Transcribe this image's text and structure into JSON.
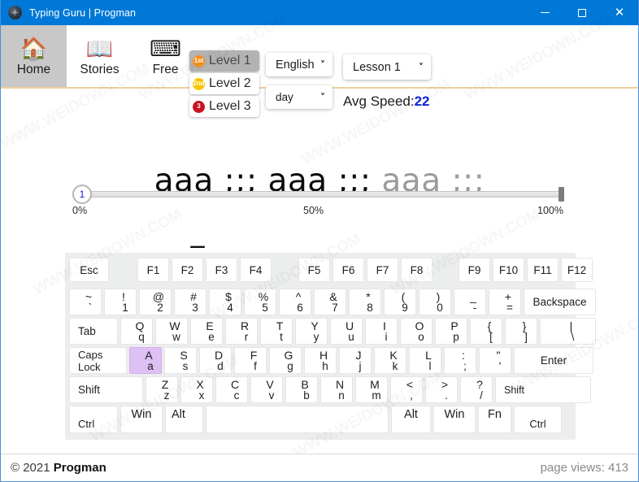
{
  "window": {
    "title": "Typing Guru | Progman",
    "app_icon": "atom-icon",
    "minimize_label": "–",
    "maximize_label": "□",
    "close_label": "✕"
  },
  "toolbar": {
    "nav": [
      {
        "id": "home",
        "label": "Home",
        "icon": "house-icon",
        "glyph": "🏠",
        "active": true
      },
      {
        "id": "stories",
        "label": "Stories",
        "icon": "open-book-icon",
        "glyph": "📖",
        "active": false
      },
      {
        "id": "free",
        "label": "Free",
        "icon": "keyboard-hands-icon",
        "glyph": "⌨",
        "active": false
      }
    ],
    "levels": [
      {
        "label": "Level 1",
        "badge": "1st",
        "badge_color": "#f5921e",
        "selected": true
      },
      {
        "label": "Level 2",
        "badge": "2nd",
        "badge_color": "#f7c600",
        "selected": false
      },
      {
        "label": "Level 3",
        "badge": "3",
        "badge_color": "#cc1122",
        "selected": false
      }
    ],
    "language_select": {
      "value": "English",
      "chevron": "⌄"
    },
    "unit_select": {
      "value": "day",
      "chevron": "⌄"
    },
    "lesson_select": {
      "value": "Lesson 1",
      "chevron": "⌄"
    },
    "avg_speed": {
      "label": "Avg Speed:",
      "value": "22"
    }
  },
  "progress": {
    "knob_value": "1",
    "ticks": {
      "start": "0%",
      "middle": "50%",
      "end": "100%"
    }
  },
  "typing": {
    "typed_text": "aaa ;;; aaa ;;; ",
    "remaining_text": "aaa ;;;",
    "input_display": "_"
  },
  "keyboard": {
    "highlighted_key": "A",
    "rows": {
      "fn": [
        "Esc",
        "F1",
        "F2",
        "F3",
        "F4",
        "F5",
        "F6",
        "F7",
        "F8",
        "F9",
        "F10",
        "F11",
        "F12"
      ],
      "num": [
        {
          "up": "~",
          "lo": "`"
        },
        {
          "up": "!",
          "lo": "1"
        },
        {
          "up": "@",
          "lo": "2"
        },
        {
          "up": "#",
          "lo": "3"
        },
        {
          "up": "$",
          "lo": "4"
        },
        {
          "up": "%",
          "lo": "5"
        },
        {
          "up": "^",
          "lo": "6"
        },
        {
          "up": "&",
          "lo": "7"
        },
        {
          "up": "*",
          "lo": "8"
        },
        {
          "up": "(",
          "lo": "9"
        },
        {
          "up": ")",
          "lo": "0"
        },
        {
          "up": "_",
          "lo": "-"
        },
        {
          "up": "+",
          "lo": "="
        },
        {
          "label": "Backspace"
        }
      ],
      "top": [
        {
          "label": "Tab"
        },
        {
          "up": "Q",
          "lo": "q"
        },
        {
          "up": "W",
          "lo": "w"
        },
        {
          "up": "E",
          "lo": "e"
        },
        {
          "up": "R",
          "lo": "r"
        },
        {
          "up": "T",
          "lo": "t"
        },
        {
          "up": "Y",
          "lo": "y"
        },
        {
          "up": "U",
          "lo": "u"
        },
        {
          "up": "I",
          "lo": "i"
        },
        {
          "up": "O",
          "lo": "o"
        },
        {
          "up": "P",
          "lo": "p"
        },
        {
          "up": "{",
          "lo": "["
        },
        {
          "up": "}",
          "lo": "]"
        },
        {
          "up": "|",
          "lo": "\\"
        }
      ],
      "home": [
        {
          "line1": "Caps",
          "line2": "Lock"
        },
        {
          "up": "A",
          "lo": "a"
        },
        {
          "up": "S",
          "lo": "s"
        },
        {
          "up": "D",
          "lo": "d"
        },
        {
          "up": "F",
          "lo": "f"
        },
        {
          "up": "G",
          "lo": "g"
        },
        {
          "up": "H",
          "lo": "h"
        },
        {
          "up": "J",
          "lo": "j"
        },
        {
          "up": "K",
          "lo": "k"
        },
        {
          "up": "L",
          "lo": "l"
        },
        {
          "up": ":",
          "lo": ";"
        },
        {
          "up": "\"",
          "lo": "'"
        },
        {
          "label": "Enter"
        }
      ],
      "bottom": [
        {
          "label": "Shift"
        },
        {
          "up": "Z",
          "lo": "z"
        },
        {
          "up": "X",
          "lo": "x"
        },
        {
          "up": "C",
          "lo": "c"
        },
        {
          "up": "V",
          "lo": "v"
        },
        {
          "up": "B",
          "lo": "b"
        },
        {
          "up": "N",
          "lo": "n"
        },
        {
          "up": "M",
          "lo": "m"
        },
        {
          "up": "<",
          "lo": ","
        },
        {
          "up": ">",
          "lo": "."
        },
        {
          "up": "?",
          "lo": "/"
        },
        {
          "label": "Shift"
        }
      ],
      "mod": [
        "Ctrl",
        "Win",
        "Alt",
        "",
        "Alt",
        "Win",
        "Fn",
        "Ctrl"
      ]
    }
  },
  "footer": {
    "copyright_prefix": "© 2021 ",
    "copyright_name": "Progman",
    "page_views": "page views: 413"
  },
  "colors": {
    "titlebar": "#0078d7",
    "accent_underline": "#f0cf9b",
    "highlight_key": "#dfc0f5",
    "avg_speed_value": "#0b24dd",
    "active_nav": "#c8c8c8"
  },
  "watermark": {
    "text": "WWW.WEIDOWN.COM"
  }
}
